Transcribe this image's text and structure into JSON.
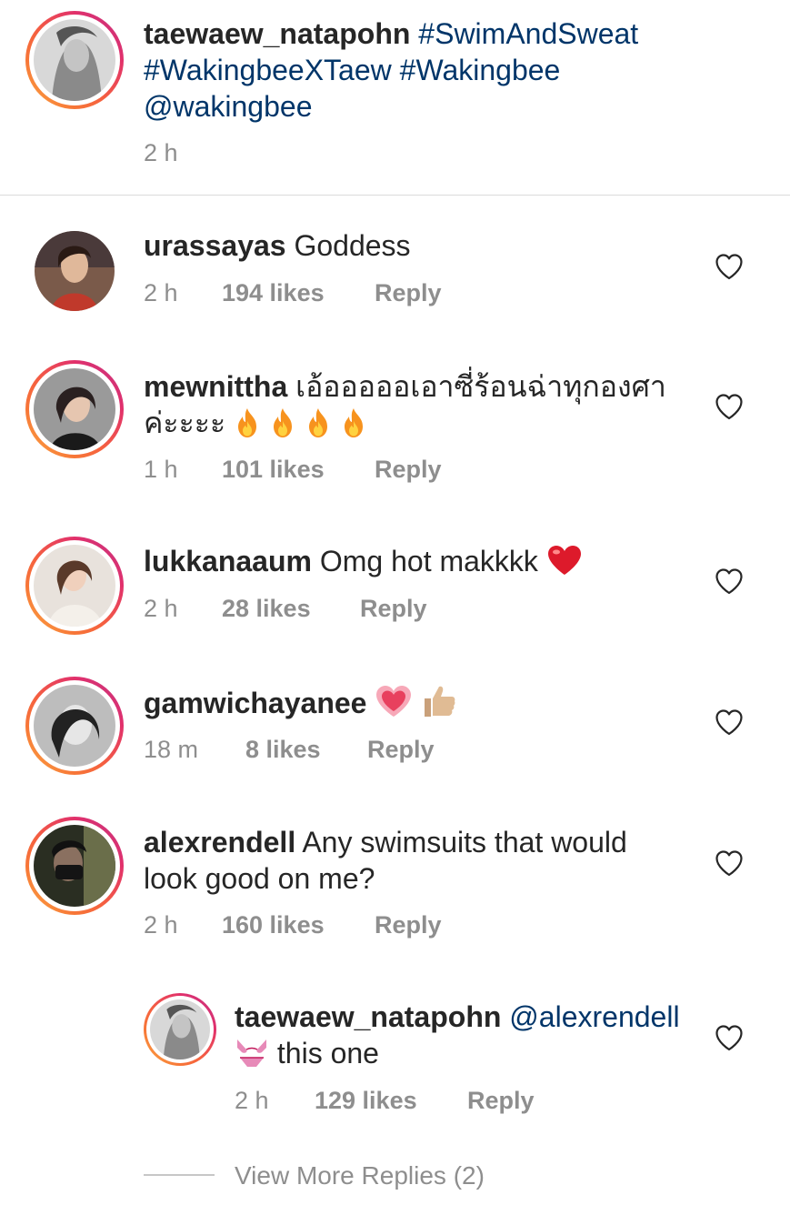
{
  "caption": {
    "username": "taewaew_natapohn",
    "line1_tag": "#SwimAndSweat",
    "line2": "#WakingbeeXTaew #Wakingbee",
    "line3": "@wakingbee",
    "time": "2 h"
  },
  "comments": [
    {
      "username": "urassayas",
      "text": "Goddess",
      "time": "2 h",
      "likes": "194 likes",
      "reply": "Reply"
    },
    {
      "username": "mewnittha",
      "text_line1": "เอ้อออออเอาซี่ร้อนฉ่าทุกองศา",
      "text_line2": "ค่ะะะะ",
      "emoji": "fire fire fire fire",
      "time": "1 h",
      "likes": "101 likes",
      "reply": "Reply"
    },
    {
      "username": "lukkanaaum",
      "text": "Omg hot makkkk",
      "emoji": "red heart",
      "time": "2 h",
      "likes": "28 likes",
      "reply": "Reply"
    },
    {
      "username": "gamwichayanee",
      "emoji": "heart, thumbs up",
      "time": "18 m",
      "likes": "8 likes",
      "reply": "Reply"
    },
    {
      "username": "alexrendell",
      "text_line1": "Any swimsuits that would",
      "text_line2": "look good on me?",
      "time": "2 h",
      "likes": "160 likes",
      "reply": "Reply"
    }
  ],
  "reply": {
    "username": "taewaew_natapohn",
    "mention": "@alexrendell",
    "emoji": "bikini",
    "text": "this one",
    "time": "2 h",
    "likes": "129 likes",
    "reply": "Reply"
  },
  "view_more": "View More Replies (2)",
  "colors": {
    "text": "#262626",
    "secondary": "#8e8e8e",
    "link": "#003569",
    "divider": "#dbdbdb"
  }
}
